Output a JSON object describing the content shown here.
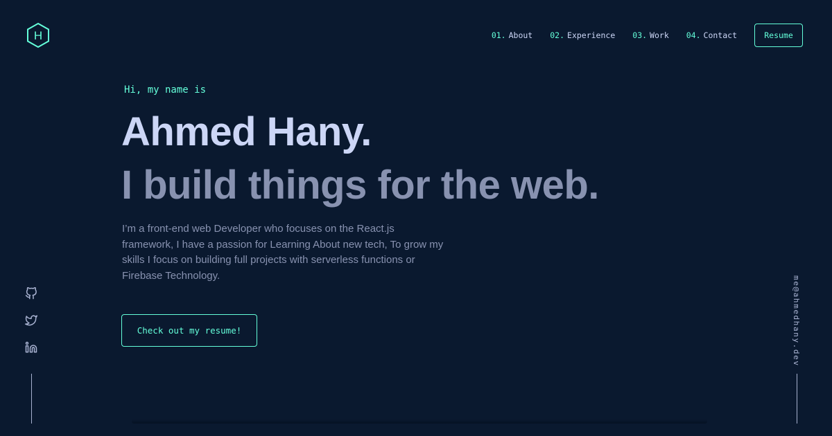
{
  "brand": {
    "logo_letter": "H",
    "accent_color": "#64ffda",
    "background_color": "#0a192f"
  },
  "nav": {
    "items": [
      {
        "number": "01.",
        "label": "About"
      },
      {
        "number": "02.",
        "label": "Experience"
      },
      {
        "number": "03.",
        "label": "Work"
      },
      {
        "number": "04.",
        "label": "Contact"
      }
    ],
    "resume_label": "Resume"
  },
  "hero": {
    "greeting": "Hi, my name is",
    "name": "Ahmed Hany.",
    "tagline": "I build things for the web.",
    "bio": "I’m a front-end web Developer who focuses on the React.js framework, I have a passion for Learning About new tech, To grow my skills I focus on building full projects with serverless functions or Firebase Technology.",
    "cta_label": "Check out my resume!"
  },
  "socials": [
    {
      "icon": "github-icon"
    },
    {
      "icon": "twitter-icon"
    },
    {
      "icon": "linkedin-icon"
    }
  ],
  "email": "me@ahmedhany.dev"
}
